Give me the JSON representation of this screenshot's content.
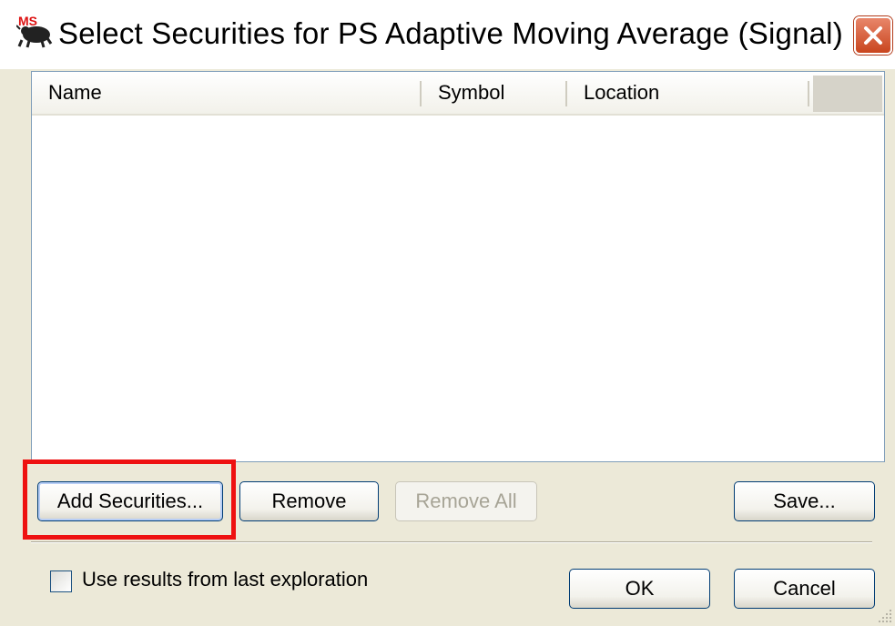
{
  "window": {
    "title": "Select Securities for PS Adaptive Moving Average (Signal)",
    "app_icon": "metastock-logo-icon",
    "close_icon": "close-icon"
  },
  "listview": {
    "columns": [
      "Name",
      "Symbol",
      "Location"
    ],
    "rows": []
  },
  "buttons": {
    "add_securities": "Add Securities...",
    "remove": "Remove",
    "remove_all": "Remove All",
    "save": "Save...",
    "ok": "OK",
    "cancel": "Cancel"
  },
  "options": {
    "use_results_label": "Use results from last exploration",
    "use_results_checked": false
  },
  "colors": {
    "highlight": "#ee1111",
    "close_button": "#c9451e",
    "dialog_background": "#ece9d8"
  }
}
